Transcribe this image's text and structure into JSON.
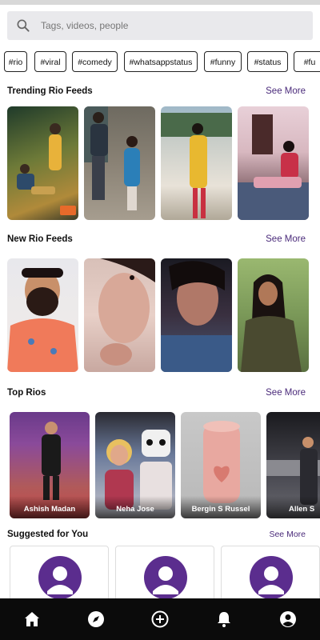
{
  "search": {
    "placeholder": "Tags, videos, people"
  },
  "tags": [
    "#rio",
    "#viral",
    "#comedy",
    "#whatsappstatus",
    "#funny",
    "#status",
    "#fu"
  ],
  "sections": {
    "trending": {
      "title": "Trending Rio Feeds",
      "see_more": "See More"
    },
    "new": {
      "title": "New Rio Feeds",
      "see_more": "See More"
    },
    "top": {
      "title": "Top Rios",
      "see_more": "See More"
    },
    "suggested": {
      "title": "Suggested for You",
      "see_more": "See More"
    }
  },
  "top_rios": [
    "Ashish Madan",
    "Neha Jose",
    "Bergin S Russel",
    "Allen S"
  ],
  "colors": {
    "accent": "#4a2a7a",
    "avatar": "#5b2d8e",
    "nav_bg": "#0b0b0b"
  },
  "nav": [
    "home-icon",
    "compass-icon",
    "add-circle-icon",
    "bell-icon",
    "profile-icon"
  ]
}
